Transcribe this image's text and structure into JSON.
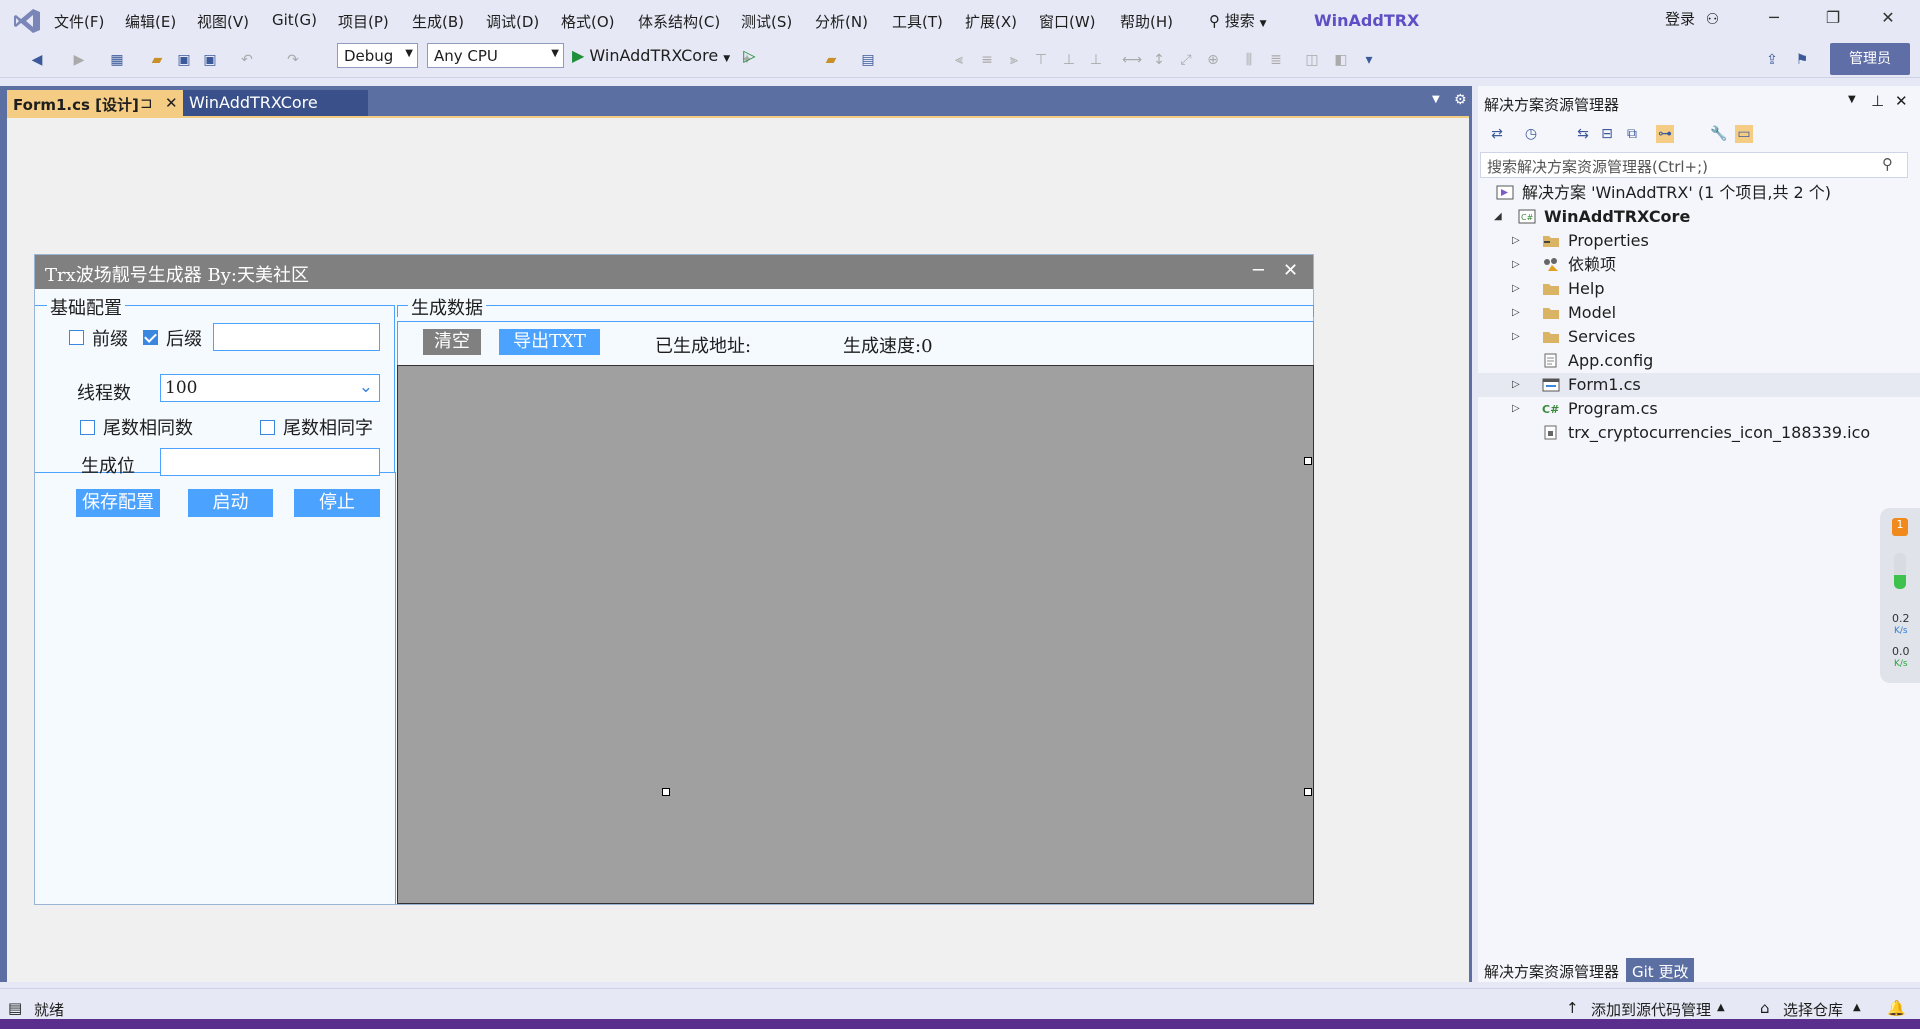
{
  "window": {
    "app_title": "WinAddTRX",
    "login": "登录",
    "admin": "管理员"
  },
  "menu": [
    "文件(F)",
    "编辑(E)",
    "视图(V)",
    "Git(G)",
    "项目(P)",
    "生成(B)",
    "调试(D)",
    "格式(O)",
    "体系结构(C)",
    "测试(S)",
    "分析(N)",
    "工具(T)",
    "扩展(X)",
    "窗口(W)",
    "帮助(H)"
  ],
  "search_label": "搜索",
  "toolbar": {
    "config": "Debug",
    "platform": "Any CPU",
    "run_target": "WinAddTRXCore"
  },
  "tabs": [
    {
      "label": "Form1.cs [设计]",
      "active": true
    },
    {
      "label": "WinAddTRXCore",
      "active": false
    }
  ],
  "form": {
    "title": "Trx波场靓号生成器 By:天美社区",
    "group_basic": "基础配置",
    "prefix": "前缀",
    "prefix_checked": false,
    "suffix": "后缀",
    "suffix_checked": true,
    "suffix_value": "",
    "threads_label": "线程数",
    "threads_value": "100",
    "tail_same_number": "尾数相同数",
    "tail_same_number_checked": false,
    "tail_same_char": "尾数相同字",
    "tail_same_char_checked": false,
    "gen_pos_label": "生成位",
    "gen_pos_value": "",
    "save_config": "保存配置",
    "start": "启动",
    "stop": "停止",
    "group_data": "生成数据",
    "clear": "清空",
    "export_txt": "导出TXT",
    "generated_label": "已生成地址:",
    "speed_label": "生成速度:0"
  },
  "solution_explorer": {
    "title": "解决方案资源管理器",
    "search_placeholder": "搜索解决方案资源管理器(Ctrl+;)",
    "solution": "解决方案 'WinAddTRX' (1 个项目,共 2 个)",
    "project": "WinAddTRXCore",
    "items": [
      {
        "label": "Properties",
        "icon": "wrench-folder-icon",
        "expandable": true
      },
      {
        "label": "依赖项",
        "icon": "dependencies-icon",
        "expandable": true
      },
      {
        "label": "Help",
        "icon": "folder-icon",
        "expandable": true
      },
      {
        "label": "Model",
        "icon": "folder-icon",
        "expandable": true
      },
      {
        "label": "Services",
        "icon": "folder-icon",
        "expandable": true
      },
      {
        "label": "App.config",
        "icon": "config-file-icon",
        "expandable": false
      },
      {
        "label": "Form1.cs",
        "icon": "form-icon",
        "expandable": true
      },
      {
        "label": "Program.cs",
        "icon": "csharp-file-icon",
        "expandable": true
      },
      {
        "label": "trx_cryptocurrencies_icon_188339.ico",
        "icon": "ico-file-icon",
        "expandable": false
      }
    ],
    "bottom_tabs": [
      "解决方案资源管理器",
      "Git 更改"
    ]
  },
  "network": {
    "up": "0.2",
    "down": "0.0",
    "unit": "K/s",
    "badge": "1"
  },
  "status": {
    "ready": "就绪",
    "add_source": "添加到源代码管理",
    "select_repo": "选择仓库"
  },
  "colors": {
    "accent": "#4ba2ff",
    "tab_active": "#f5cc84",
    "brand": "#5f4fc4"
  }
}
